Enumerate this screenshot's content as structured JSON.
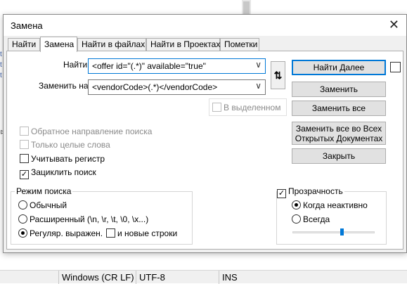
{
  "dialog": {
    "title": "Замена",
    "close_glyph": "✕"
  },
  "tabs": [
    {
      "label": "Найти"
    },
    {
      "label": "Замена"
    },
    {
      "label": "Найти в файлах"
    },
    {
      "label": "Найти в Проектах"
    },
    {
      "label": "Пометки"
    }
  ],
  "find": {
    "label": "Найти:",
    "value": "<offer id=\"(.*)\" available=\"true\""
  },
  "replace": {
    "label": "Заменить на:",
    "value": "<vendorCode>(.*)</vendorCode>"
  },
  "swap_glyph": "⇅",
  "combo_arrow": "∨",
  "in_selection": "В выделенном",
  "buttons": {
    "find_next": "Найти Далее",
    "replace": "Заменить",
    "replace_all": "Заменить все",
    "replace_all_open_line1": "Заменить все во Всех",
    "replace_all_open_line2": "Открытых Документах",
    "close": "Закрыть"
  },
  "options": {
    "backward": "Обратное направление поиска",
    "whole_word": "Только целые слова",
    "match_case": "Учитывать регистр",
    "wrap": "Зациклить поиск"
  },
  "search_mode": {
    "title": "Режим поиска",
    "normal": "Обычный",
    "extended": "Расширенный (\\n, \\r, \\t, \\0, \\x...)",
    "regex": "Регуляр. выражен.",
    "newline": "и новые строки"
  },
  "transparency": {
    "title": "Прозрачность",
    "on_lose_focus": "Когда неактивно",
    "always": "Всегда",
    "level": 0.6
  },
  "statusbar": {
    "eol": "Windows (CR LF)",
    "encoding": "UTF-8",
    "mode": "INS"
  },
  "colors": {
    "accent": "#0078d7",
    "dialog_bg": "#f0f0f0"
  }
}
